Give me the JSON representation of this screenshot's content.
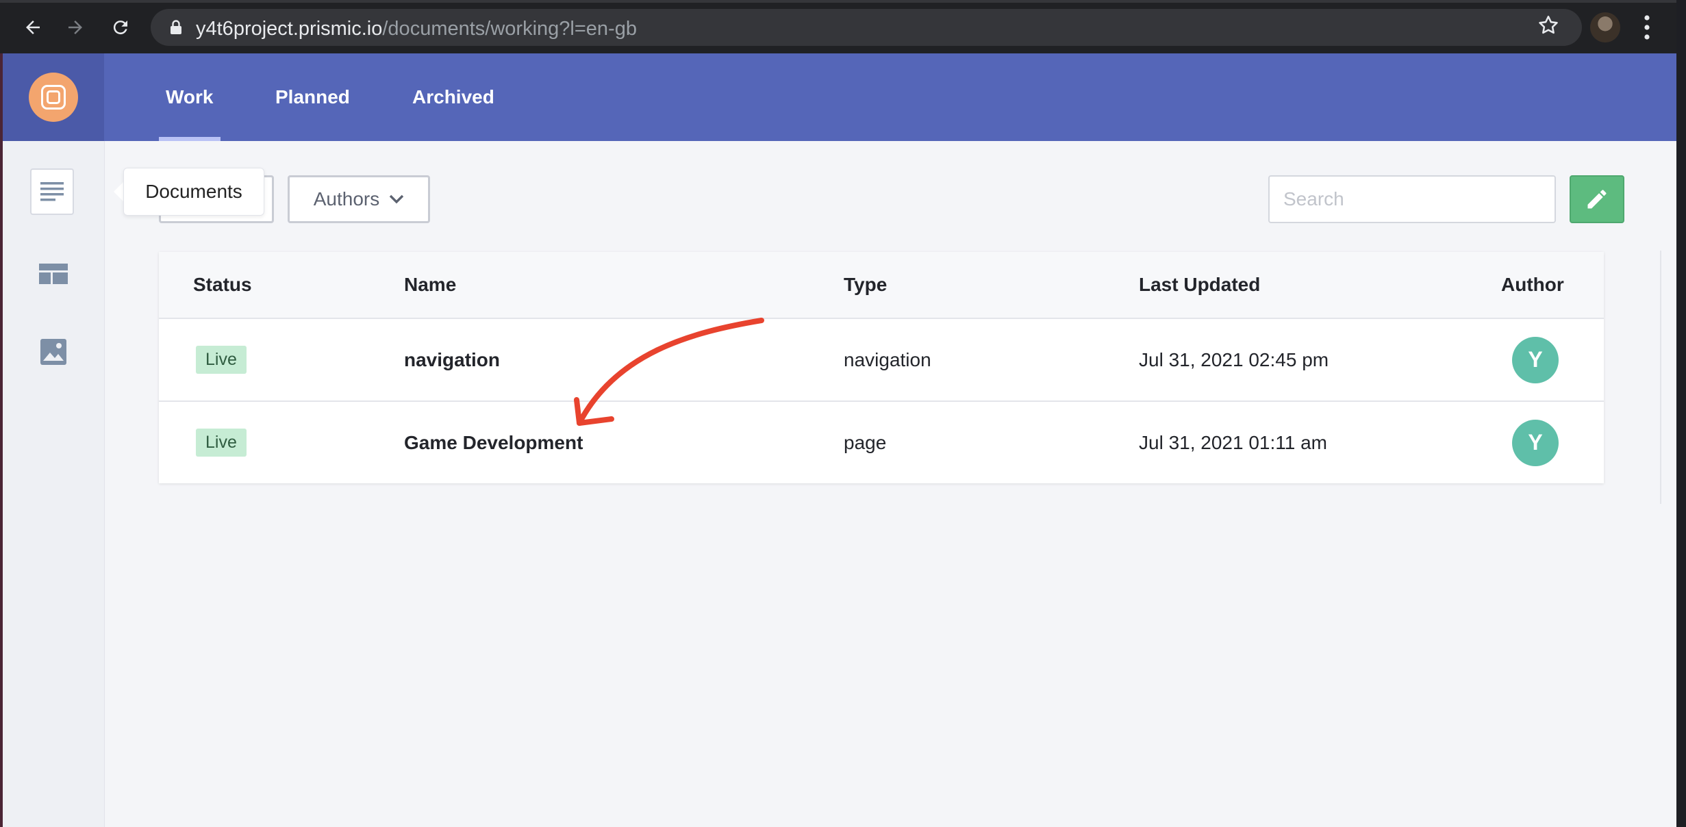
{
  "browser": {
    "url_host": "y4t6project.prismic.io",
    "url_path": "/documents/working?l=en-gb"
  },
  "header": {
    "tabs": [
      {
        "label": "Work",
        "active": true
      },
      {
        "label": "Planned",
        "active": false
      },
      {
        "label": "Archived",
        "active": false
      }
    ]
  },
  "sidebar": {
    "items": [
      {
        "icon": "documents-icon",
        "active": true
      },
      {
        "icon": "custom-types-icon",
        "active": false
      },
      {
        "icon": "media-library-icon",
        "active": false
      }
    ]
  },
  "tooltip": {
    "text": "Documents"
  },
  "filters": {
    "authors_label": "Authors"
  },
  "search": {
    "placeholder": "Search"
  },
  "table": {
    "headers": {
      "status": "Status",
      "name": "Name",
      "type": "Type",
      "last_updated": "Last Updated",
      "author": "Author"
    },
    "rows": [
      {
        "status": "Live",
        "name": "navigation",
        "type": "navigation",
        "last_updated": "Jul 31, 2021 02:45 pm",
        "author_initial": "Y"
      },
      {
        "status": "Live",
        "name": "Game Development",
        "type": "page",
        "last_updated": "Jul 31, 2021 01:11 am",
        "author_initial": "Y"
      }
    ]
  },
  "colors": {
    "header_bg": "#5566b8",
    "accent_green": "#5dbb7f",
    "status_live_bg": "#c6ecd4",
    "avatar_bg": "#5fbfa9",
    "annotation_arrow": "#e8432e"
  }
}
